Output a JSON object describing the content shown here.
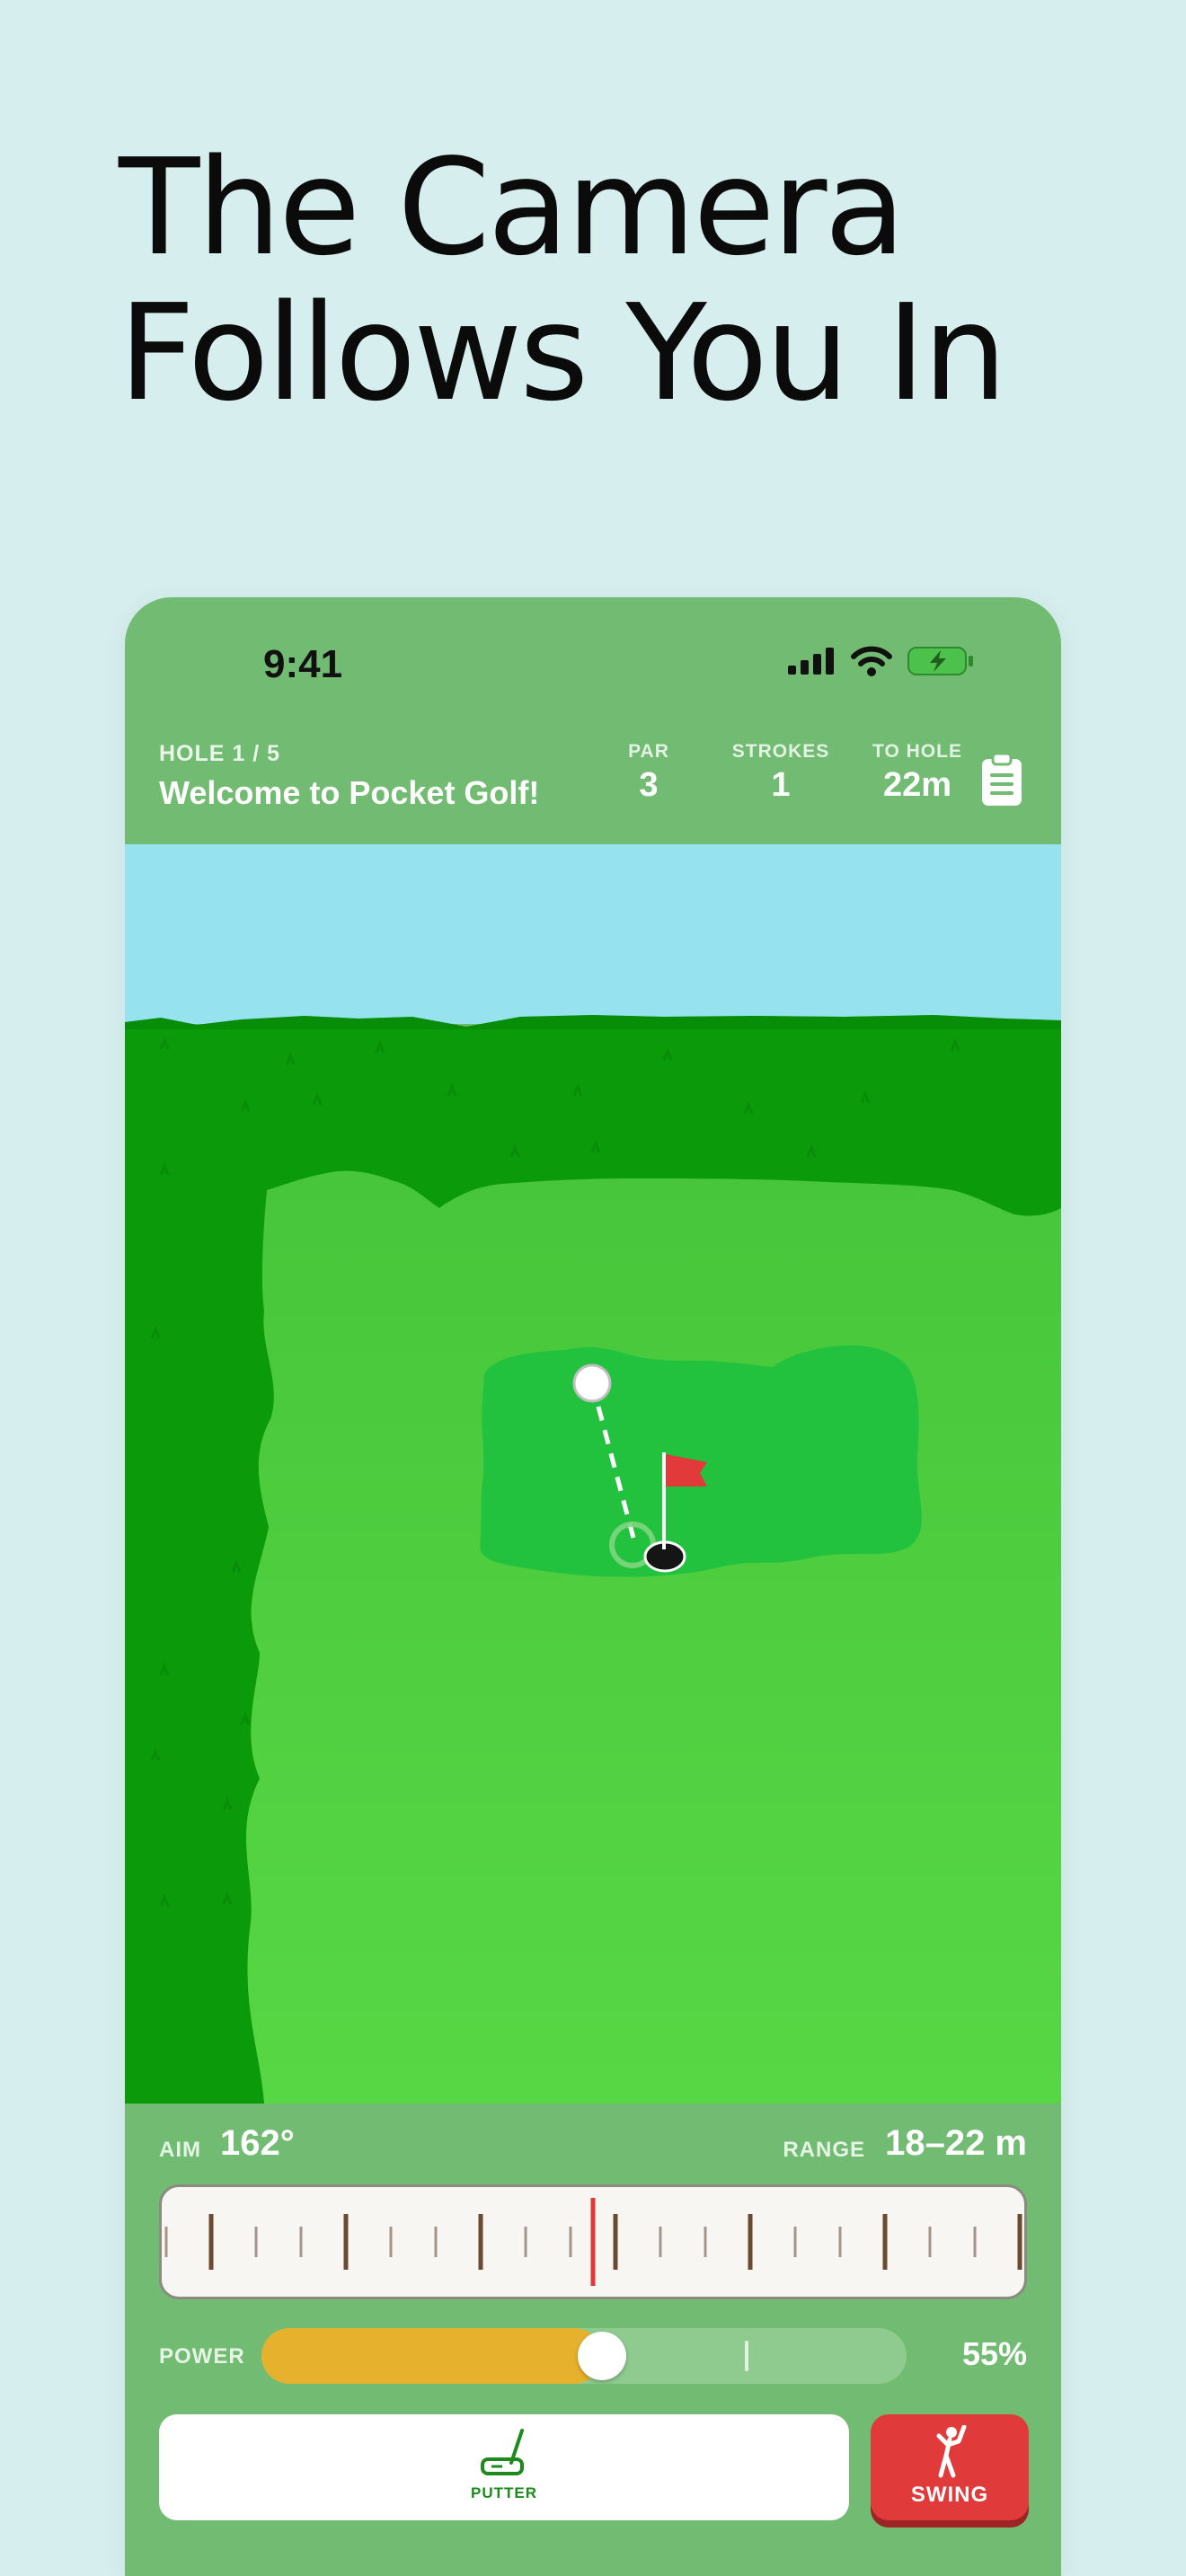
{
  "headline": {
    "line1": "The Camera",
    "line2": "Follows You In"
  },
  "status_bar": {
    "time": "9:41"
  },
  "hud": {
    "hole_label": "HOLE 1 / 5",
    "hole_title": "Welcome to Pocket Golf!",
    "stats": [
      {
        "label": "PAR",
        "value": "3"
      },
      {
        "label": "STROKES",
        "value": "1"
      },
      {
        "label": "TO HOLE",
        "value": "22m"
      }
    ],
    "scorecard_icon": "clipboard-icon"
  },
  "controls": {
    "aim_label": "AIM",
    "aim_value": "162°",
    "range_label": "RANGE",
    "range_value": "18–22 m",
    "power_label": "POWER",
    "power_value": "55%",
    "power_fraction": 0.55,
    "club_label": "PUTTER",
    "club_icon": "putter-icon",
    "swing_label": "SWING",
    "swing_icon": "golfer-icon"
  },
  "colors": {
    "background": "#d6eeee",
    "frame": "#72bb72",
    "sky": "#97e2ef",
    "rough": "#0a9a0a",
    "fairway": "#4fcf3f",
    "green": "#22c23e",
    "flag": "#e23a3a",
    "power": "#e6b22e",
    "swing_button": "#e03a3a"
  }
}
